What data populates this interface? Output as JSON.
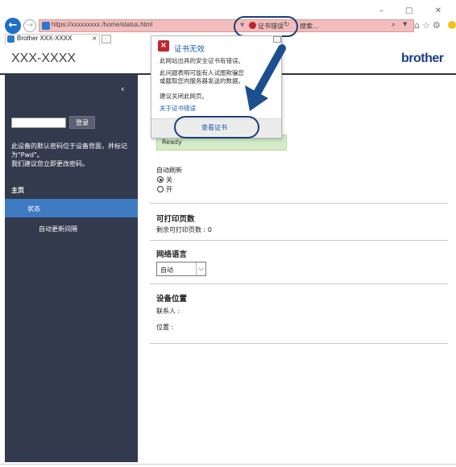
{
  "browser": {
    "window_controls": "– □ ✕",
    "url": "https://xxxxxxxxx /home/status.html",
    "cert_error": "证书错误",
    "search_text": "搜索...",
    "tab_title": "Brother XXX-XXXX",
    "tab_close": "×",
    "nav_icons": "⌂☆⚙"
  },
  "header": {
    "model": "XXX-XXXX",
    "brand": "brother"
  },
  "sidebar": {
    "collapse": "‹",
    "login_button": "登录",
    "password_notice": "此设备的默认密码位于设备背面，并标记为\"Pwd\"。\n我们建议您立即更改密码。",
    "home": "主页",
    "items": [
      {
        "label": "状态"
      },
      {
        "label": "自动更新间隔"
      }
    ]
  },
  "popup": {
    "title": "证书无效",
    "line1": "此网站出具的安全证书有错误。",
    "line2": "此问题表明可能有人试图欺骗您或截取您向服务器发送的数据。",
    "line3": "建议关闭此网页。",
    "link": "关于证书错误",
    "view_cert": "查看证书"
  },
  "main": {
    "status": "Ready",
    "auto_refresh_label": "自动刷新",
    "auto_refresh_options": [
      "关",
      "开"
    ],
    "auto_refresh_selected": "关",
    "printable_pages_title": "可打印页数",
    "remaining_pages": "剩余可打印页数 : 0",
    "web_language_title": "网络语言",
    "web_language_value": "自动",
    "device_location_title": "设备位置",
    "contact": "联系人 :",
    "location": "位置 :"
  },
  "colors": {
    "accent": "#3f7bc3",
    "sidebar": "#333a4d",
    "address_error": "#f4bdbd",
    "brand": "#1a3f86",
    "highlight_ring": "#1a3f7a"
  }
}
